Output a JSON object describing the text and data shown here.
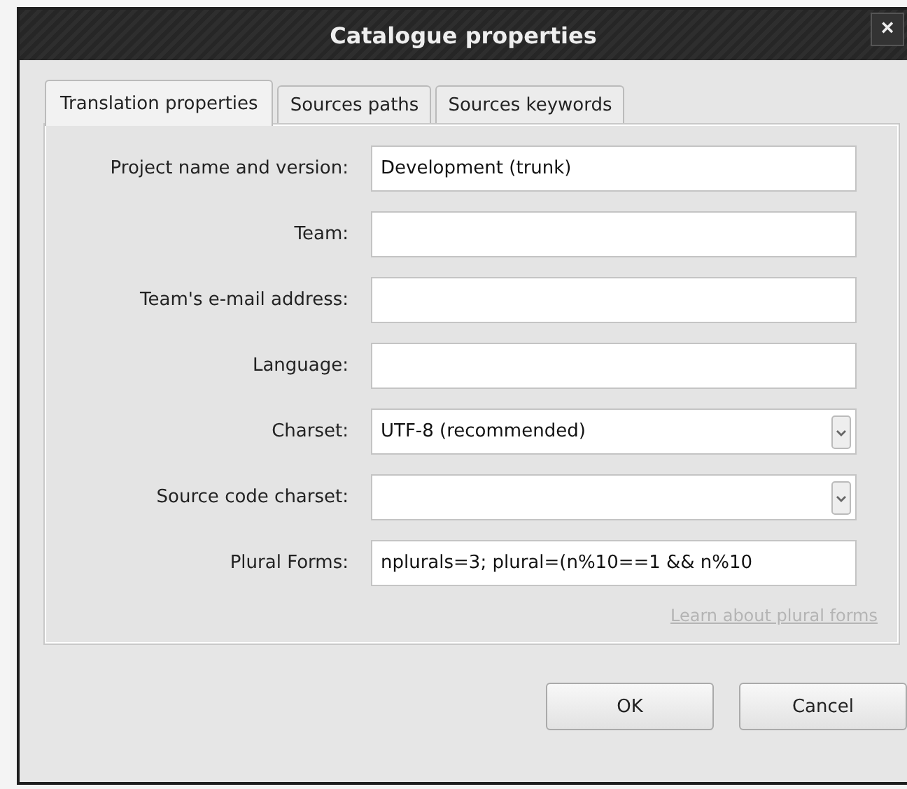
{
  "window": {
    "title": "Catalogue properties",
    "close": "×"
  },
  "tabs": [
    {
      "label": "Translation properties",
      "selected": true
    },
    {
      "label": "Sources paths",
      "selected": false
    },
    {
      "label": "Sources keywords",
      "selected": false
    }
  ],
  "fields": [
    {
      "label": "Project name and version:",
      "kind": "text",
      "value": "Development (trunk)"
    },
    {
      "label": "Team:",
      "kind": "text"
    },
    {
      "label": "Team's e-mail address:",
      "kind": "text"
    },
    {
      "label": "Language:",
      "kind": "text"
    },
    {
      "label": "Charset:",
      "kind": "combo",
      "value": "UTF-8 (recommended)"
    },
    {
      "label": "Source code charset:",
      "kind": "combo"
    },
    {
      "label": "Plural Forms:",
      "kind": "text",
      "value": "nplurals=3; plural=(n%10==1 && n%10"
    }
  ],
  "link": {
    "label": "Learn about plural forms",
    "disabled": true
  },
  "buttons": [
    "OK",
    "Cancel"
  ]
}
